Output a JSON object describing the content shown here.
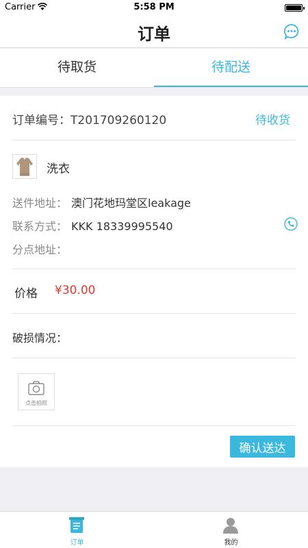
{
  "status_bar": {
    "carrier": "Carrier",
    "time": "5:58 PM"
  },
  "header": {
    "title": "订单"
  },
  "tabs": [
    {
      "label": "待取货",
      "active": false
    },
    {
      "label": "待配送",
      "active": true
    }
  ],
  "order": {
    "number_label": "订单编号：",
    "number": "T201709260120",
    "status": "待收货",
    "product_name": "洗衣",
    "send_address_label": "送件地址：",
    "send_address": "澳门花地玛堂区leakage",
    "contact_label": "联系方式：",
    "contact": "KKK  18339995540",
    "branch_address_label": "分点地址：",
    "branch_address": "",
    "price_label": "价格",
    "price": "¥30.00",
    "damage_label": "破损情况：",
    "photo_caption": "点击拍照"
  },
  "actions": {
    "confirm_label": "确认送达"
  },
  "tab_bar": [
    {
      "label": "订单",
      "icon": "order-list-icon",
      "active": true
    },
    {
      "label": "我的",
      "icon": "profile-icon",
      "active": false
    }
  ],
  "colors": {
    "accent": "#3bb8dd",
    "price": "#e8372c",
    "background": "#efeff4"
  }
}
